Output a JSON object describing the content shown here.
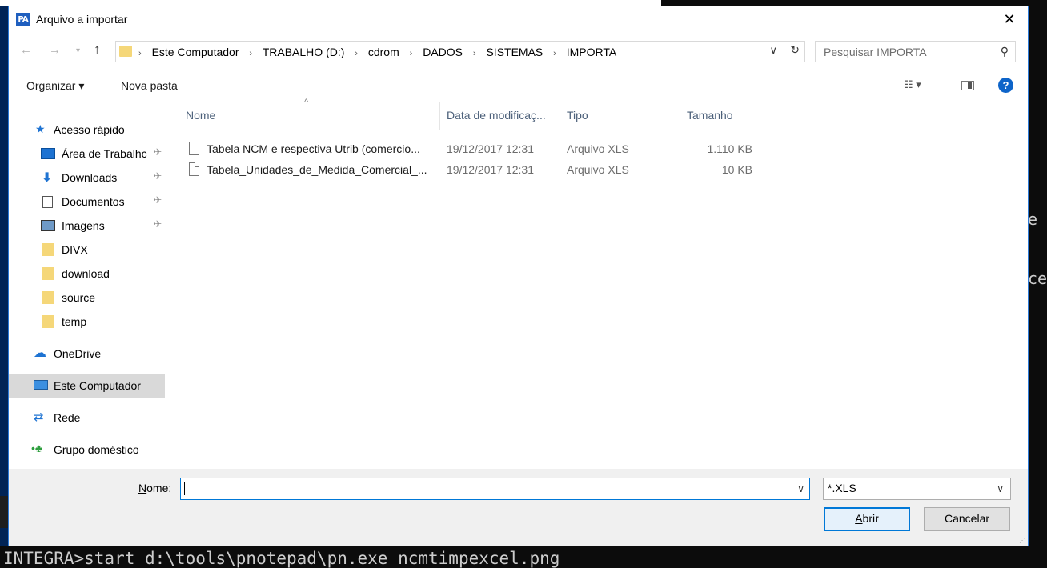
{
  "console": {
    "command": "INTEGRA>start d:\\tools\\pnotepad\\pn.exe ncmtimpexcel.png",
    "frag_e": "e",
    "frag_ce": "ce"
  },
  "dialog": {
    "title": "Arquivo a importar",
    "app_icon_text": "PA",
    "close_glyph": "✕"
  },
  "address": {
    "crumbs": [
      "Este Computador",
      "TRABALHO (D:)",
      "cdrom",
      "DADOS",
      "SISTEMAS",
      "IMPORTA"
    ],
    "search_placeholder": "Pesquisar IMPORTA"
  },
  "toolbar": {
    "organize": "Organizar ▾",
    "new_folder": "Nova pasta",
    "help": "?"
  },
  "navpane": {
    "quick_access": "Acesso rápido",
    "desktop": "Área de Trabalhc",
    "downloads": "Downloads",
    "documents": "Documentos",
    "images": "Imagens",
    "divx": "DIVX",
    "download": "download",
    "source": "source",
    "temp": "temp",
    "onedrive": "OneDrive",
    "this_pc": "Este Computador",
    "network": "Rede",
    "homegroup": "Grupo doméstico"
  },
  "columns": {
    "name": "Nome",
    "modified": "Data de modificaç...",
    "type": "Tipo",
    "size": "Tamanho"
  },
  "files": [
    {
      "name": "Tabela NCM e respectiva Utrib (comercio...",
      "modified": "19/12/2017 12:31",
      "type": "Arquivo XLS",
      "size": "1.110 KB"
    },
    {
      "name": "Tabela_Unidades_de_Medida_Comercial_...",
      "modified": "19/12/2017 12:31",
      "type": "Arquivo XLS",
      "size": "10 KB"
    }
  ],
  "bottom": {
    "name_label_underlined": "N",
    "name_label_rest": "ome:",
    "name_value": "",
    "filter_value": "*.XLS",
    "open_underlined": "A",
    "open_rest": "brir",
    "cancel": "Cancelar"
  },
  "colors": {
    "accent": "#0078d7",
    "console_bg": "#0c0c0c",
    "folder": "#f5d779"
  }
}
